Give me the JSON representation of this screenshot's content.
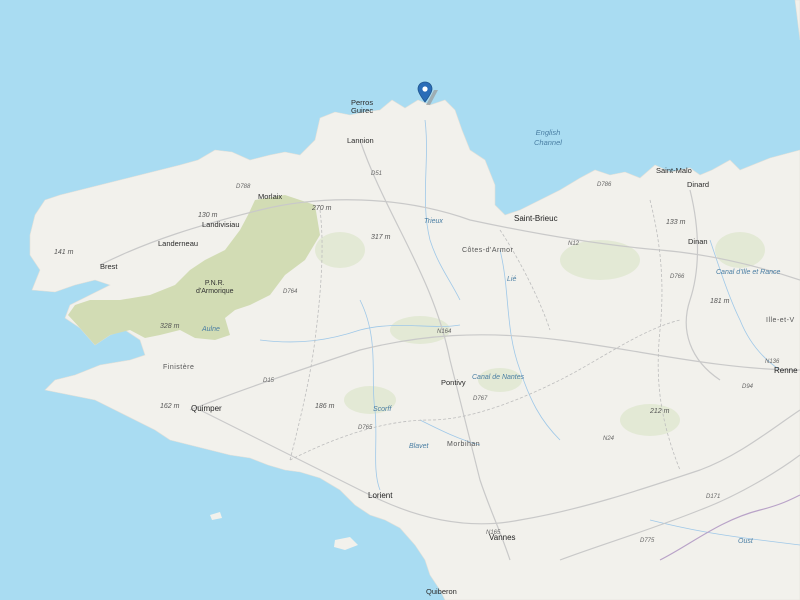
{
  "map": {
    "colors": {
      "sea": "#a9dcf2",
      "land": "#f2f1ec",
      "park": "#d2dcb4",
      "road": "#c8c8c8",
      "river": "#9fc8e8",
      "marker": "#2a6db8"
    },
    "marker": {
      "icon": "map-pin-icon"
    },
    "sea_label": [
      "English",
      "Channel"
    ],
    "park_label": [
      "P.N.R.",
      "d'Armorique"
    ],
    "cities": {
      "perros_guirec": [
        "Perros",
        "Guirec"
      ],
      "lannion": "Lannion",
      "morlaix": "Morlaix",
      "landivisiau": "Landivisiau",
      "landerneau": "Landerneau",
      "brest": "Brest",
      "saint_malo": "Saint-Malo",
      "dinard": "Dinard",
      "saint_brieuc": "Saint-Brieuc",
      "dinan": "Dinan",
      "quimper": "Quimper",
      "pontivy": "Pontivy",
      "lorient": "Lorient",
      "vannes": "Vannes",
      "quiberon": "Quiberon",
      "rennes": "Renne",
      "ille_et_v": "Ille-et-V"
    },
    "regions": {
      "cotes_darmor": "Côtes-d'Armor",
      "finistere": "Finistère",
      "morbihan": "Morbihan"
    },
    "elevations": {
      "e141": "141 m",
      "e130": "130 m",
      "e270": "270 m",
      "e317": "317 m",
      "e328": "328 m",
      "e162": "162 m",
      "e186": "186 m",
      "e133": "133 m",
      "e181": "181 m",
      "e212": "212 m"
    },
    "roads": {
      "d786": "D786",
      "d788": "D788",
      "d51": "D51",
      "d764": "D764",
      "n12": "N12",
      "n164": "N164",
      "d15": "D15",
      "d767": "D767",
      "d765": "D765",
      "n24": "N24",
      "n165": "N165",
      "d775": "D775",
      "d766": "D766",
      "d171": "D171",
      "n136": "N136",
      "d94": "D94"
    },
    "waters": {
      "trieux": "Trieux",
      "lie": "Lié",
      "aulne": "Aulne",
      "scorff": "Scorff",
      "blavet": "Blavet",
      "canal_nantes": "Canal de Nantes",
      "canal_rance": "Canal d'Ille et Rance",
      "oust": "Oust"
    }
  }
}
